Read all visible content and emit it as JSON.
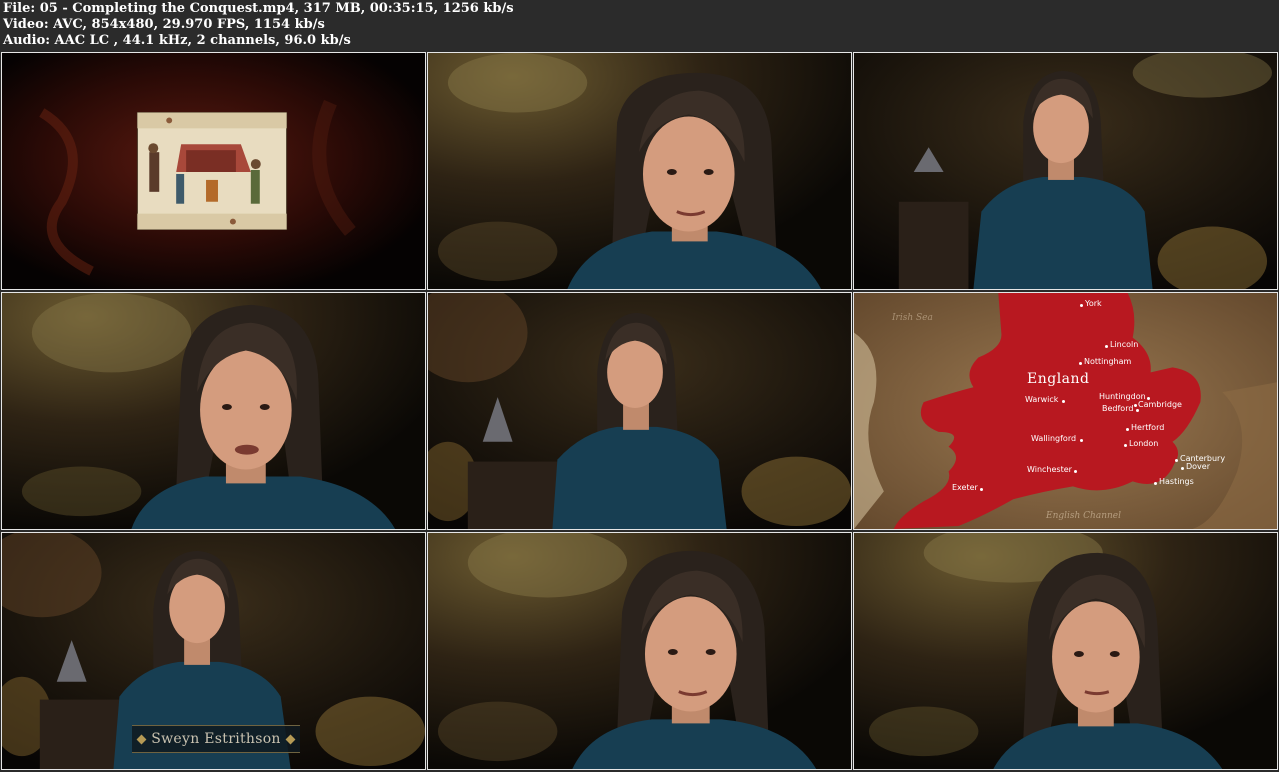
{
  "header": {
    "file_line": "File: 05 - Completing the Conquest.mp4, 317 MB, 00:35:15, 1256 kb/s",
    "video_line": "Video: AVC, 854x480, 29.970 FPS, 1154 kb/s",
    "audio_line": "Audio: AAC LC , 44.1 kHz, 2 channels, 96.0 kb/s"
  },
  "caption": {
    "name": "Sweyn Estrithson"
  },
  "map": {
    "country": "England",
    "sea_top": "Irish Sea",
    "sea_bottom": "English Channel",
    "towns": {
      "york": "York",
      "lincoln": "Lincoln",
      "nottingham": "Nottingham",
      "warwick": "Warwick",
      "huntingdon": "Huntingdon",
      "bedford": "Bedford",
      "cambridge": "Cambridge",
      "hertford": "Hertford",
      "wallingford": "Wallingford",
      "london": "London",
      "winchester": "Winchester",
      "canterbury": "Canterbury",
      "dover": "Dover",
      "hastings": "Hastings",
      "exeter": "Exeter"
    }
  },
  "colors": {
    "background": "#2b2b2b",
    "frame_border": "#e6e6e6",
    "map_red": "#b81820",
    "map_parchment": "#8c6a45",
    "blouse": "#173e52"
  }
}
